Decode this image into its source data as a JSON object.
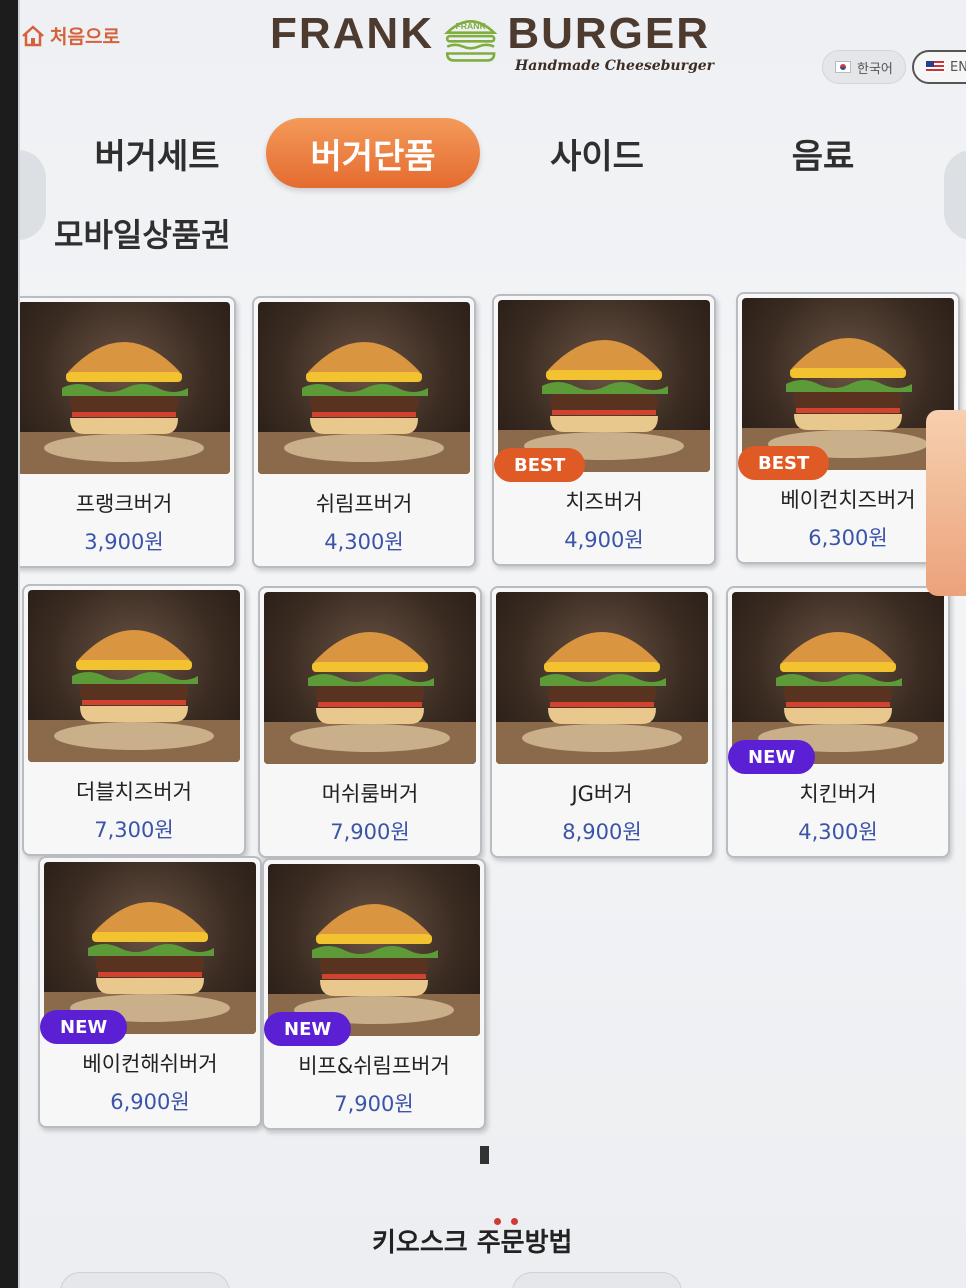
{
  "header": {
    "home_label": "처음으로",
    "logo_left": "FRANK",
    "logo_badge": "FRANK",
    "logo_right": "BURGER",
    "logo_sub": "Handmade Cheeseburger",
    "lang_ko": "한국어",
    "lang_en": "EN"
  },
  "tabs": [
    {
      "label": "버거세트",
      "active": false
    },
    {
      "label": "버거단품",
      "active": true
    },
    {
      "label": "사이드",
      "active": false
    },
    {
      "label": "음료",
      "active": false
    }
  ],
  "subtab": "모바일상품권",
  "accent_color": "#e56b2f",
  "price_color": "#3a54a8",
  "products": [
    {
      "name": "프랭크버거",
      "price": "3,900원",
      "badge": ""
    },
    {
      "name": "쉬림프버거",
      "price": "4,300원",
      "badge": ""
    },
    {
      "name": "치즈버거",
      "price": "4,900원",
      "badge": "BEST"
    },
    {
      "name": "베이컨치즈버거",
      "price": "6,300원",
      "badge": "BEST"
    },
    {
      "name": "더블치즈버거",
      "price": "7,300원",
      "badge": ""
    },
    {
      "name": "머쉬룸버거",
      "price": "7,900원",
      "badge": ""
    },
    {
      "name": "JG버거",
      "price": "8,900원",
      "badge": ""
    },
    {
      "name": "치킨버거",
      "price": "4,300원",
      "badge": "NEW"
    },
    {
      "name": "베이컨해쉬버거",
      "price": "6,900원",
      "badge": "NEW"
    },
    {
      "name": "비프&쉬림프버거",
      "price": "7,900원",
      "badge": "NEW"
    }
  ],
  "footer": {
    "guide_label": "키오스크 주문방법"
  }
}
